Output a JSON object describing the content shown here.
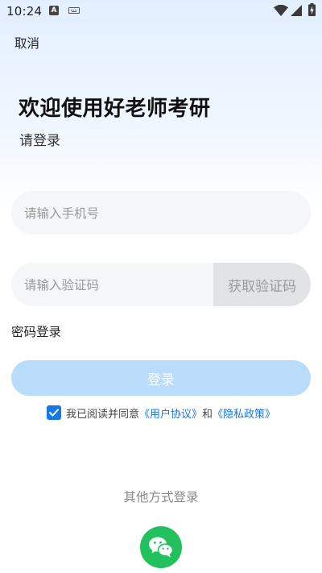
{
  "status_bar": {
    "time": "10:24",
    "notification_letter": "A",
    "icons": [
      "a-notification-icon",
      "keyboard-icon",
      "wifi-icon",
      "signal-icon",
      "battery-charging-icon"
    ]
  },
  "header": {
    "cancel_label": "取消"
  },
  "welcome": {
    "title": "欢迎使用好老师考研",
    "subtitle": "请登录"
  },
  "form": {
    "phone_placeholder": "请输入手机号",
    "phone_value": "",
    "code_placeholder": "请输入验证码",
    "code_value": "",
    "get_code_label": "获取验证码",
    "password_login_label": "密码登录",
    "login_label": "登录"
  },
  "agreement": {
    "checked": true,
    "prefix": "我已阅读并同意",
    "user_agreement": "《用户协议》",
    "and": "和",
    "privacy_policy": "《隐私政策》"
  },
  "other_login": {
    "label": "其他方式登录",
    "methods": [
      "wechat-icon"
    ]
  },
  "colors": {
    "accent": "#1677e6",
    "login_button_disabled": "#b9dcfb",
    "wechat_green": "#22c15e",
    "input_background": "#f5f6f7",
    "get_code_background": "#e2e3e5"
  }
}
